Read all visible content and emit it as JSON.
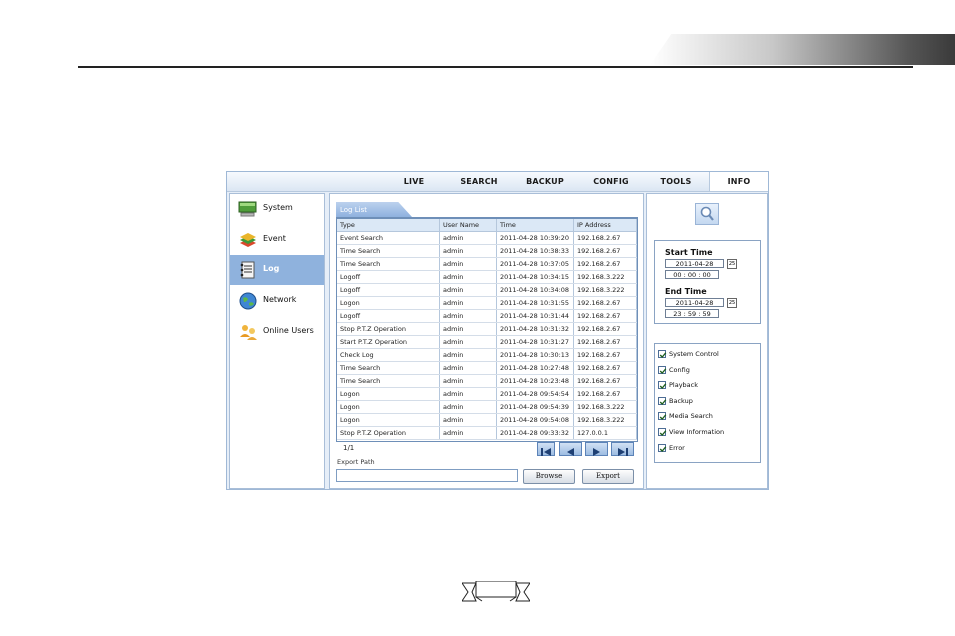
{
  "nav": {
    "tabs": [
      {
        "label": "LIVE",
        "active": false
      },
      {
        "label": "SEARCH",
        "active": false
      },
      {
        "label": "BACKUP",
        "active": false
      },
      {
        "label": "CONFIG",
        "active": false
      },
      {
        "label": "TOOLS",
        "active": false
      },
      {
        "label": "INFO",
        "active": true
      }
    ]
  },
  "sidebar": {
    "items": [
      {
        "label": "System",
        "icon": "monitor-icon",
        "active": false
      },
      {
        "label": "Event",
        "icon": "stack-icon",
        "active": false
      },
      {
        "label": "Log",
        "icon": "log-icon",
        "active": true
      },
      {
        "label": "Network",
        "icon": "globe-icon",
        "active": false
      },
      {
        "label": "Online Users",
        "icon": "users-icon",
        "active": false
      }
    ]
  },
  "log": {
    "tab_label": "Log List",
    "columns": [
      "Type",
      "User Name",
      "Time",
      "IP Address"
    ],
    "rows": [
      [
        "Event Search",
        "admin",
        "2011-04-28 10:39:20",
        "192.168.2.67"
      ],
      [
        "Time Search",
        "admin",
        "2011-04-28 10:38:33",
        "192.168.2.67"
      ],
      [
        "Time Search",
        "admin",
        "2011-04-28 10:37:05",
        "192.168.2.67"
      ],
      [
        "Logoff",
        "admin",
        "2011-04-28 10:34:15",
        "192.168.3.222"
      ],
      [
        "Logoff",
        "admin",
        "2011-04-28 10:34:08",
        "192.168.3.222"
      ],
      [
        "Logon",
        "admin",
        "2011-04-28 10:31:55",
        "192.168.2.67"
      ],
      [
        "Logoff",
        "admin",
        "2011-04-28 10:31:44",
        "192.168.2.67"
      ],
      [
        "Stop P.T.Z Operation",
        "admin",
        "2011-04-28 10:31:32",
        "192.168.2.67"
      ],
      [
        "Start P.T.Z Operation",
        "admin",
        "2011-04-28 10:31:27",
        "192.168.2.67"
      ],
      [
        "Check Log",
        "admin",
        "2011-04-28 10:30:13",
        "192.168.2.67"
      ],
      [
        "Time Search",
        "admin",
        "2011-04-28 10:27:48",
        "192.168.2.67"
      ],
      [
        "Time Search",
        "admin",
        "2011-04-28 10:23:48",
        "192.168.2.67"
      ],
      [
        "Logon",
        "admin",
        "2011-04-28 09:54:54",
        "192.168.2.67"
      ],
      [
        "Logon",
        "admin",
        "2011-04-28 09:54:39",
        "192.168.3.222"
      ],
      [
        "Logon",
        "admin",
        "2011-04-28 09:54:08",
        "192.168.3.222"
      ],
      [
        "Stop P.T.Z Operation",
        "admin",
        "2011-04-28 09:33:32",
        "127.0.0.1"
      ]
    ],
    "page_indicator": "1/1",
    "export_label": "Export Path",
    "export_value": "",
    "browse_label": "Browse",
    "export_button_label": "Export"
  },
  "filters": {
    "start_label": "Start Time",
    "start_date": "2011-04-28",
    "start_time": "00 : 00 : 00",
    "end_label": "End Time",
    "end_date": "2011-04-28",
    "end_time": "23 : 59 : 59",
    "calendar_icon_text": "25",
    "options": [
      {
        "label": "System Control",
        "checked": true
      },
      {
        "label": "Config",
        "checked": true
      },
      {
        "label": "Playback",
        "checked": true
      },
      {
        "label": "Backup",
        "checked": true
      },
      {
        "label": "Media Search",
        "checked": true
      },
      {
        "label": "View Information",
        "checked": true
      },
      {
        "label": "Error",
        "checked": true
      }
    ]
  },
  "colors": {
    "accent": "#8fb2dd",
    "border": "#a9bed8"
  }
}
